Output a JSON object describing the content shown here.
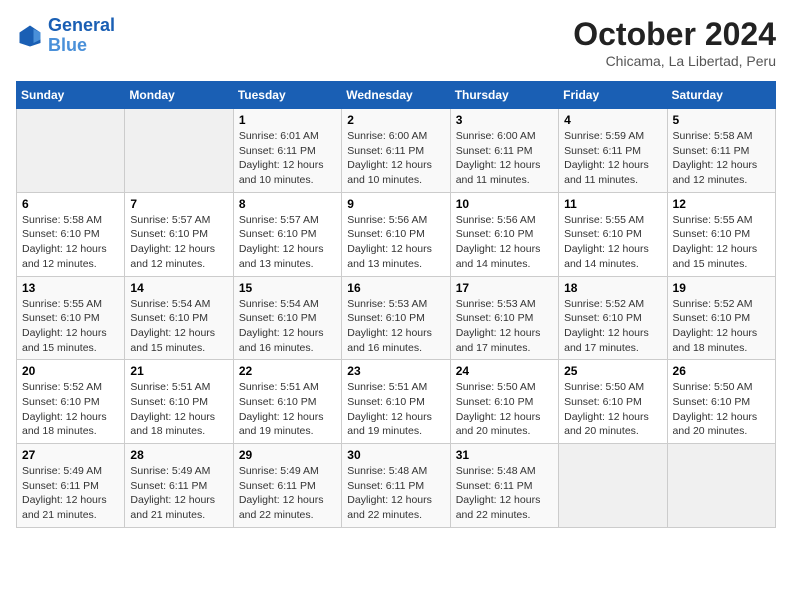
{
  "header": {
    "logo_line1": "General",
    "logo_line2": "Blue",
    "month": "October 2024",
    "location": "Chicama, La Libertad, Peru"
  },
  "days_of_week": [
    "Sunday",
    "Monday",
    "Tuesday",
    "Wednesday",
    "Thursday",
    "Friday",
    "Saturday"
  ],
  "weeks": [
    [
      {
        "day": "",
        "sunrise": "",
        "sunset": "",
        "daylight": ""
      },
      {
        "day": "",
        "sunrise": "",
        "sunset": "",
        "daylight": ""
      },
      {
        "day": "1",
        "sunrise": "Sunrise: 6:01 AM",
        "sunset": "Sunset: 6:11 PM",
        "daylight": "Daylight: 12 hours and 10 minutes."
      },
      {
        "day": "2",
        "sunrise": "Sunrise: 6:00 AM",
        "sunset": "Sunset: 6:11 PM",
        "daylight": "Daylight: 12 hours and 10 minutes."
      },
      {
        "day": "3",
        "sunrise": "Sunrise: 6:00 AM",
        "sunset": "Sunset: 6:11 PM",
        "daylight": "Daylight: 12 hours and 11 minutes."
      },
      {
        "day": "4",
        "sunrise": "Sunrise: 5:59 AM",
        "sunset": "Sunset: 6:11 PM",
        "daylight": "Daylight: 12 hours and 11 minutes."
      },
      {
        "day": "5",
        "sunrise": "Sunrise: 5:58 AM",
        "sunset": "Sunset: 6:11 PM",
        "daylight": "Daylight: 12 hours and 12 minutes."
      }
    ],
    [
      {
        "day": "6",
        "sunrise": "Sunrise: 5:58 AM",
        "sunset": "Sunset: 6:10 PM",
        "daylight": "Daylight: 12 hours and 12 minutes."
      },
      {
        "day": "7",
        "sunrise": "Sunrise: 5:57 AM",
        "sunset": "Sunset: 6:10 PM",
        "daylight": "Daylight: 12 hours and 12 minutes."
      },
      {
        "day": "8",
        "sunrise": "Sunrise: 5:57 AM",
        "sunset": "Sunset: 6:10 PM",
        "daylight": "Daylight: 12 hours and 13 minutes."
      },
      {
        "day": "9",
        "sunrise": "Sunrise: 5:56 AM",
        "sunset": "Sunset: 6:10 PM",
        "daylight": "Daylight: 12 hours and 13 minutes."
      },
      {
        "day": "10",
        "sunrise": "Sunrise: 5:56 AM",
        "sunset": "Sunset: 6:10 PM",
        "daylight": "Daylight: 12 hours and 14 minutes."
      },
      {
        "day": "11",
        "sunrise": "Sunrise: 5:55 AM",
        "sunset": "Sunset: 6:10 PM",
        "daylight": "Daylight: 12 hours and 14 minutes."
      },
      {
        "day": "12",
        "sunrise": "Sunrise: 5:55 AM",
        "sunset": "Sunset: 6:10 PM",
        "daylight": "Daylight: 12 hours and 15 minutes."
      }
    ],
    [
      {
        "day": "13",
        "sunrise": "Sunrise: 5:55 AM",
        "sunset": "Sunset: 6:10 PM",
        "daylight": "Daylight: 12 hours and 15 minutes."
      },
      {
        "day": "14",
        "sunrise": "Sunrise: 5:54 AM",
        "sunset": "Sunset: 6:10 PM",
        "daylight": "Daylight: 12 hours and 15 minutes."
      },
      {
        "day": "15",
        "sunrise": "Sunrise: 5:54 AM",
        "sunset": "Sunset: 6:10 PM",
        "daylight": "Daylight: 12 hours and 16 minutes."
      },
      {
        "day": "16",
        "sunrise": "Sunrise: 5:53 AM",
        "sunset": "Sunset: 6:10 PM",
        "daylight": "Daylight: 12 hours and 16 minutes."
      },
      {
        "day": "17",
        "sunrise": "Sunrise: 5:53 AM",
        "sunset": "Sunset: 6:10 PM",
        "daylight": "Daylight: 12 hours and 17 minutes."
      },
      {
        "day": "18",
        "sunrise": "Sunrise: 5:52 AM",
        "sunset": "Sunset: 6:10 PM",
        "daylight": "Daylight: 12 hours and 17 minutes."
      },
      {
        "day": "19",
        "sunrise": "Sunrise: 5:52 AM",
        "sunset": "Sunset: 6:10 PM",
        "daylight": "Daylight: 12 hours and 18 minutes."
      }
    ],
    [
      {
        "day": "20",
        "sunrise": "Sunrise: 5:52 AM",
        "sunset": "Sunset: 6:10 PM",
        "daylight": "Daylight: 12 hours and 18 minutes."
      },
      {
        "day": "21",
        "sunrise": "Sunrise: 5:51 AM",
        "sunset": "Sunset: 6:10 PM",
        "daylight": "Daylight: 12 hours and 18 minutes."
      },
      {
        "day": "22",
        "sunrise": "Sunrise: 5:51 AM",
        "sunset": "Sunset: 6:10 PM",
        "daylight": "Daylight: 12 hours and 19 minutes."
      },
      {
        "day": "23",
        "sunrise": "Sunrise: 5:51 AM",
        "sunset": "Sunset: 6:10 PM",
        "daylight": "Daylight: 12 hours and 19 minutes."
      },
      {
        "day": "24",
        "sunrise": "Sunrise: 5:50 AM",
        "sunset": "Sunset: 6:10 PM",
        "daylight": "Daylight: 12 hours and 20 minutes."
      },
      {
        "day": "25",
        "sunrise": "Sunrise: 5:50 AM",
        "sunset": "Sunset: 6:10 PM",
        "daylight": "Daylight: 12 hours and 20 minutes."
      },
      {
        "day": "26",
        "sunrise": "Sunrise: 5:50 AM",
        "sunset": "Sunset: 6:10 PM",
        "daylight": "Daylight: 12 hours and 20 minutes."
      }
    ],
    [
      {
        "day": "27",
        "sunrise": "Sunrise: 5:49 AM",
        "sunset": "Sunset: 6:11 PM",
        "daylight": "Daylight: 12 hours and 21 minutes."
      },
      {
        "day": "28",
        "sunrise": "Sunrise: 5:49 AM",
        "sunset": "Sunset: 6:11 PM",
        "daylight": "Daylight: 12 hours and 21 minutes."
      },
      {
        "day": "29",
        "sunrise": "Sunrise: 5:49 AM",
        "sunset": "Sunset: 6:11 PM",
        "daylight": "Daylight: 12 hours and 22 minutes."
      },
      {
        "day": "30",
        "sunrise": "Sunrise: 5:48 AM",
        "sunset": "Sunset: 6:11 PM",
        "daylight": "Daylight: 12 hours and 22 minutes."
      },
      {
        "day": "31",
        "sunrise": "Sunrise: 5:48 AM",
        "sunset": "Sunset: 6:11 PM",
        "daylight": "Daylight: 12 hours and 22 minutes."
      },
      {
        "day": "",
        "sunrise": "",
        "sunset": "",
        "daylight": ""
      },
      {
        "day": "",
        "sunrise": "",
        "sunset": "",
        "daylight": ""
      }
    ]
  ]
}
